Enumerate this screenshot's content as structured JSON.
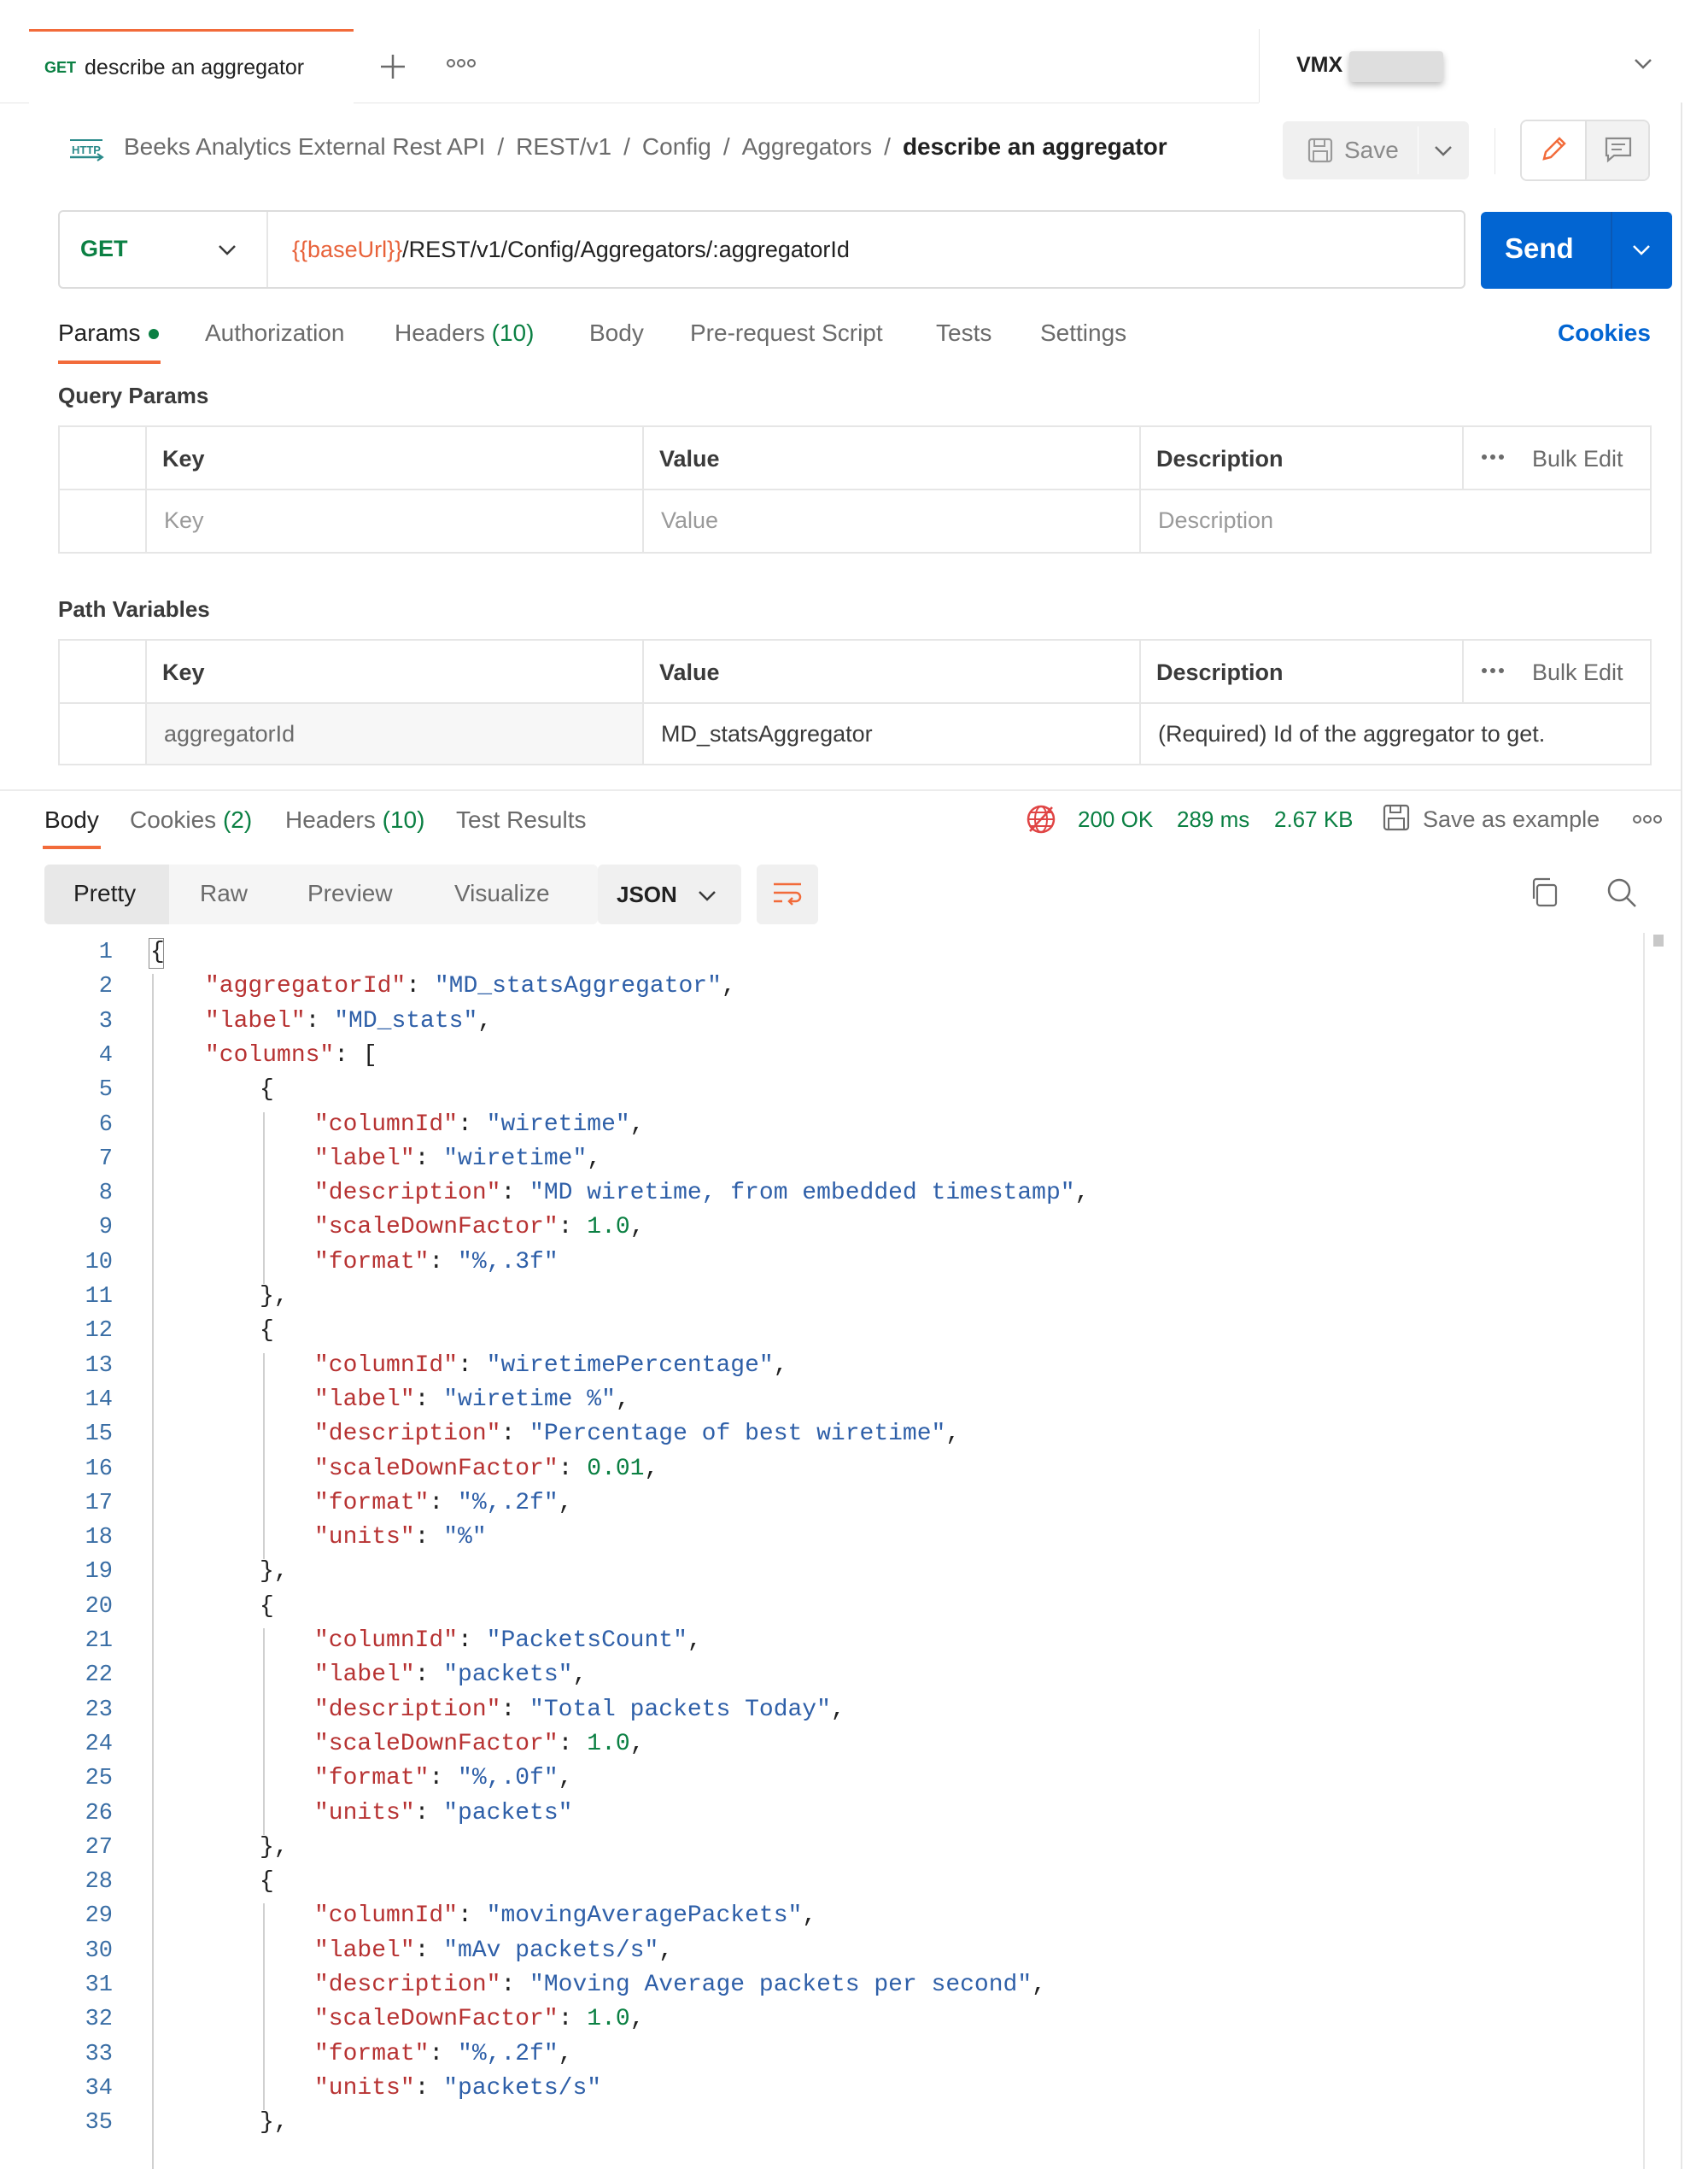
{
  "tab": {
    "method": "GET",
    "title": "describe an aggregator"
  },
  "environment": {
    "label": "VMX"
  },
  "breadcrumb": {
    "items": [
      "Beeks Analytics External Rest API",
      "REST/v1",
      "Config",
      "Aggregators"
    ],
    "current": "describe an aggregator",
    "separator": "/"
  },
  "toolbar": {
    "save_label": "Save"
  },
  "request": {
    "method": "GET",
    "url_var": "{{baseUrl}}",
    "url_path": "/REST/v1/Config/Aggregators/:aggregatorId",
    "send_label": "Send"
  },
  "request_tabs": [
    {
      "label": "Params",
      "count": ""
    },
    {
      "label": "Authorization",
      "count": ""
    },
    {
      "label": "Headers",
      "count": "(10)"
    },
    {
      "label": "Body",
      "count": ""
    },
    {
      "label": "Pre-request Script",
      "count": ""
    },
    {
      "label": "Tests",
      "count": ""
    },
    {
      "label": "Settings",
      "count": ""
    }
  ],
  "cookies_link": "Cookies",
  "query_params": {
    "title": "Query Params",
    "headers": [
      "Key",
      "Value",
      "Description"
    ],
    "bulk_edit": "Bulk Edit",
    "placeholders": [
      "Key",
      "Value",
      "Description"
    ]
  },
  "path_variables": {
    "title": "Path Variables",
    "headers": [
      "Key",
      "Value",
      "Description"
    ],
    "bulk_edit": "Bulk Edit",
    "row": {
      "key": "aggregatorId",
      "value": "MD_statsAggregator",
      "description": "(Required) Id of the aggregator to get."
    }
  },
  "response_tabs": [
    {
      "label": "Body",
      "count": ""
    },
    {
      "label": "Cookies",
      "count": "(2)"
    },
    {
      "label": "Headers",
      "count": "(10)"
    },
    {
      "label": "Test Results",
      "count": ""
    }
  ],
  "response_meta": {
    "status": "200 OK",
    "time": "289 ms",
    "size": "2.67 KB",
    "save_example": "Save as example"
  },
  "view_tabs": [
    "Pretty",
    "Raw",
    "Preview",
    "Visualize"
  ],
  "format_select": "JSON",
  "code_lines": [
    "1",
    "2",
    "3",
    "4",
    "5",
    "6",
    "7",
    "8",
    "9",
    "10",
    "11",
    "12",
    "13",
    "14",
    "15",
    "16",
    "17",
    "18",
    "19",
    "20",
    "21",
    "22",
    "23",
    "24",
    "25",
    "26",
    "27",
    "28",
    "29",
    "30",
    "31",
    "32",
    "33",
    "34",
    "35"
  ],
  "json": {
    "brace_open": "{",
    "bracket_open": "[",
    "obj_open": "{",
    "obj_close": "},",
    "top": [
      {
        "key": "\"aggregatorId\"",
        "value": "\"MD_statsAggregator\"",
        "type": "s"
      },
      {
        "key": "\"label\"",
        "value": "\"MD_stats\"",
        "type": "s"
      },
      {
        "key": "\"columns\"",
        "value": "[",
        "type": "p"
      }
    ],
    "columns": [
      [
        {
          "key": "\"columnId\"",
          "value": "\"wiretime\"",
          "type": "s"
        },
        {
          "key": "\"label\"",
          "value": "\"wiretime\"",
          "type": "s"
        },
        {
          "key": "\"description\"",
          "value": "\"MD wiretime, from embedded timestamp\"",
          "type": "s"
        },
        {
          "key": "\"scaleDownFactor\"",
          "value": "1.0",
          "type": "n"
        },
        {
          "key": "\"format\"",
          "value": "\"%,.3f\"",
          "type": "s"
        }
      ],
      [
        {
          "key": "\"columnId\"",
          "value": "\"wiretimePercentage\"",
          "type": "s"
        },
        {
          "key": "\"label\"",
          "value": "\"wiretime %\"",
          "type": "s"
        },
        {
          "key": "\"description\"",
          "value": "\"Percentage of best wiretime\"",
          "type": "s"
        },
        {
          "key": "\"scaleDownFactor\"",
          "value": "0.01",
          "type": "n"
        },
        {
          "key": "\"format\"",
          "value": "\"%,.2f\"",
          "type": "s"
        },
        {
          "key": "\"units\"",
          "value": "\"%\"",
          "type": "s"
        }
      ],
      [
        {
          "key": "\"columnId\"",
          "value": "\"PacketsCount\"",
          "type": "s"
        },
        {
          "key": "\"label\"",
          "value": "\"packets\"",
          "type": "s"
        },
        {
          "key": "\"description\"",
          "value": "\"Total packets Today\"",
          "type": "s"
        },
        {
          "key": "\"scaleDownFactor\"",
          "value": "1.0",
          "type": "n"
        },
        {
          "key": "\"format\"",
          "value": "\"%,.0f\"",
          "type": "s"
        },
        {
          "key": "\"units\"",
          "value": "\"packets\"",
          "type": "s"
        }
      ],
      [
        {
          "key": "\"columnId\"",
          "value": "\"movingAveragePackets\"",
          "type": "s"
        },
        {
          "key": "\"label\"",
          "value": "\"mAv packets/s\"",
          "type": "s"
        },
        {
          "key": "\"description\"",
          "value": "\"Moving Average packets per second\"",
          "type": "s"
        },
        {
          "key": "\"scaleDownFactor\"",
          "value": "1.0",
          "type": "n"
        },
        {
          "key": "\"format\"",
          "value": "\"%,.2f\"",
          "type": "s"
        },
        {
          "key": "\"units\"",
          "value": "\"packets/s\"",
          "type": "s"
        }
      ]
    ]
  },
  "colors": {
    "accent": "#f26b3a",
    "primary": "#0265d2",
    "success": "#0b8043",
    "json_key": "#b73232",
    "json_string": "#2e5fa8"
  }
}
